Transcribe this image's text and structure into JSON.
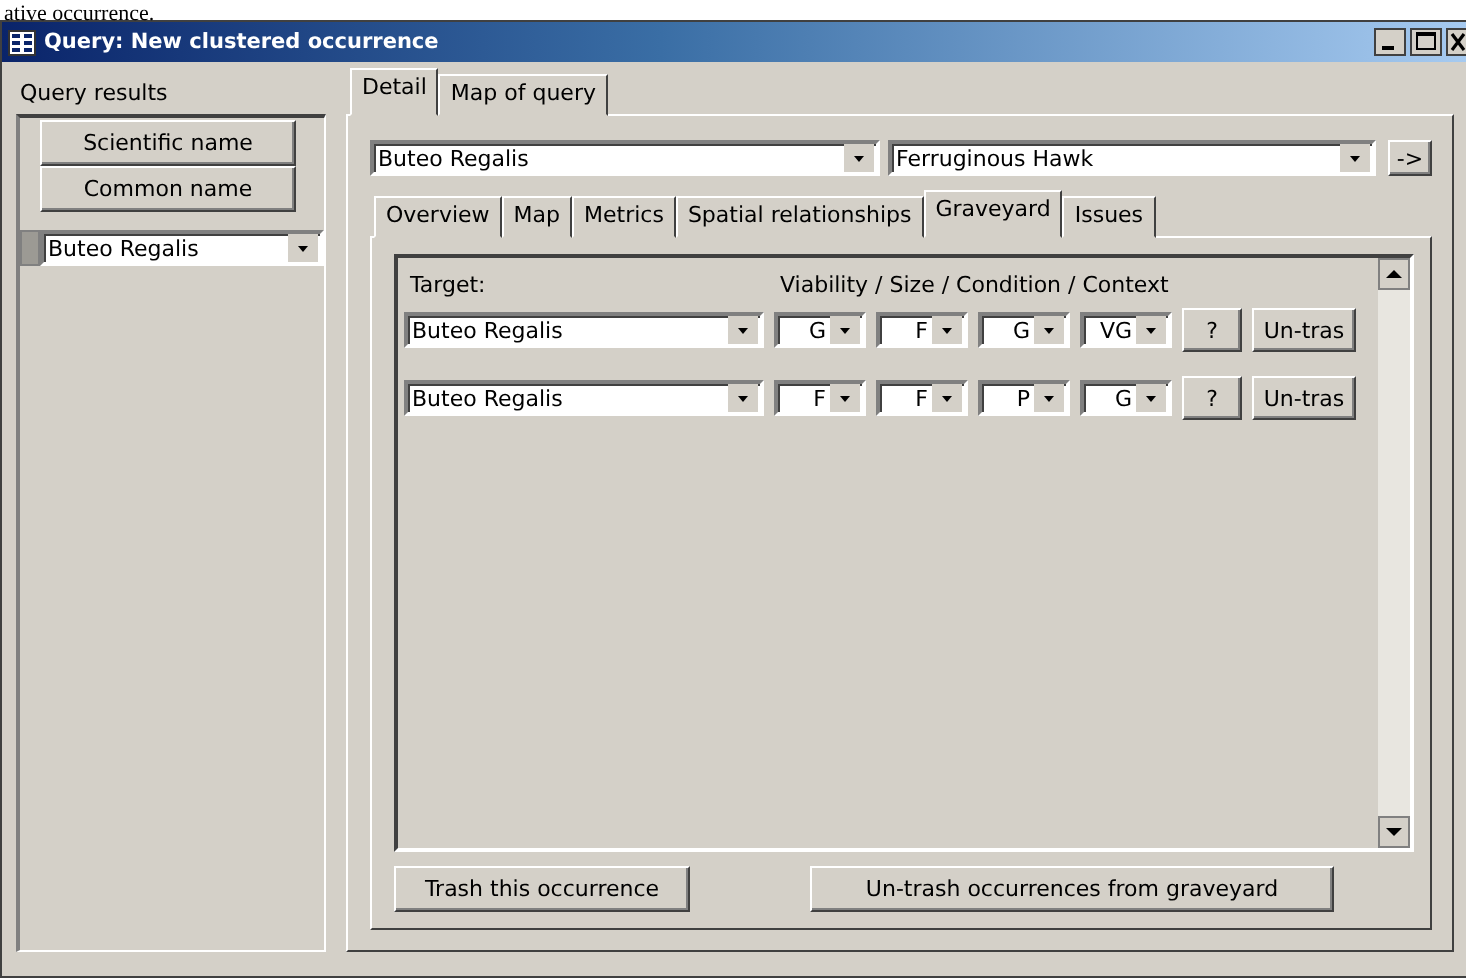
{
  "document_text": "ative occurrence.",
  "window": {
    "title": "Query: New clustered occurrence"
  },
  "query_results": {
    "label": "Query results",
    "buttons": [
      "Scientific name",
      "Common name"
    ],
    "records": [
      {
        "value": "Buteo Regalis"
      }
    ]
  },
  "tabs": [
    {
      "label": "Detail",
      "selected": true
    },
    {
      "label": "Map of query",
      "selected": false
    }
  ],
  "detail": {
    "scientific_name": "Buteo Regalis",
    "common_name": "Ferruginous Hawk",
    "go_button": "->",
    "tabs": [
      {
        "label": "Overview",
        "selected": false
      },
      {
        "label": "Map",
        "selected": false
      },
      {
        "label": "Metrics",
        "selected": false
      },
      {
        "label": "Spatial relationships",
        "selected": false
      },
      {
        "label": "Graveyard",
        "selected": true
      },
      {
        "label": "Issues",
        "selected": false
      }
    ],
    "graveyard": {
      "target_label": "Target:",
      "ratings_label": "Viability / Size / Condition / Context",
      "rows": [
        {
          "target": "Buteo Regalis",
          "ratings": [
            "G",
            "F",
            "G",
            "VG"
          ],
          "help_button": "?",
          "untrash_button": "Un-tras"
        },
        {
          "target": "Buteo Regalis",
          "ratings": [
            "F",
            "F",
            "P",
            "G"
          ],
          "help_button": "?",
          "untrash_button": "Un-tras"
        }
      ]
    },
    "buttons": [
      "Trash this occurrence",
      "Un-trash occurrences from graveyard"
    ]
  }
}
